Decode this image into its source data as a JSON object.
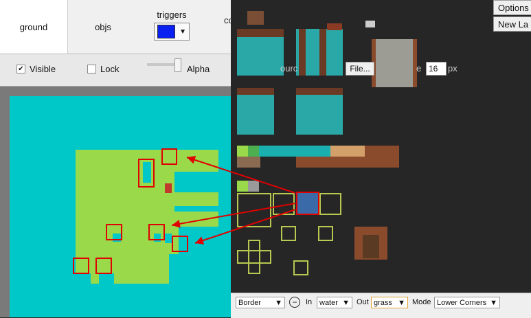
{
  "tabs": {
    "ground": "ground",
    "objs": "objs",
    "triggers": "triggers",
    "collision_partial": "coll"
  },
  "trigger_color": "#0000ff",
  "layer": {
    "visible_label": "Visible",
    "lock_label": "Lock",
    "alpha_label": "Alpha",
    "visible_checked": "✔",
    "lock_checked": ""
  },
  "toolbar": {
    "options_label": "Options",
    "new_layer_label": "New La"
  },
  "source_row": {
    "source_partial": "ourc",
    "file_button": "File...",
    "size_partial": "e",
    "tile_size": "16",
    "unit": "px"
  },
  "autotile": {
    "mode_select": "Border",
    "in_label": "In",
    "in_value": "water",
    "out_label": "Out",
    "out_value": "grass",
    "mode_label": "Mode",
    "corner_value": "Lower Corners"
  },
  "colors": {
    "water": "#00c8c8",
    "grass": "#9ad94a",
    "highlight": "#e00000",
    "tileset_bg": "#262626"
  },
  "icons": {
    "minus": "minus-circle-icon",
    "dropdown": "chevron-down-icon"
  }
}
